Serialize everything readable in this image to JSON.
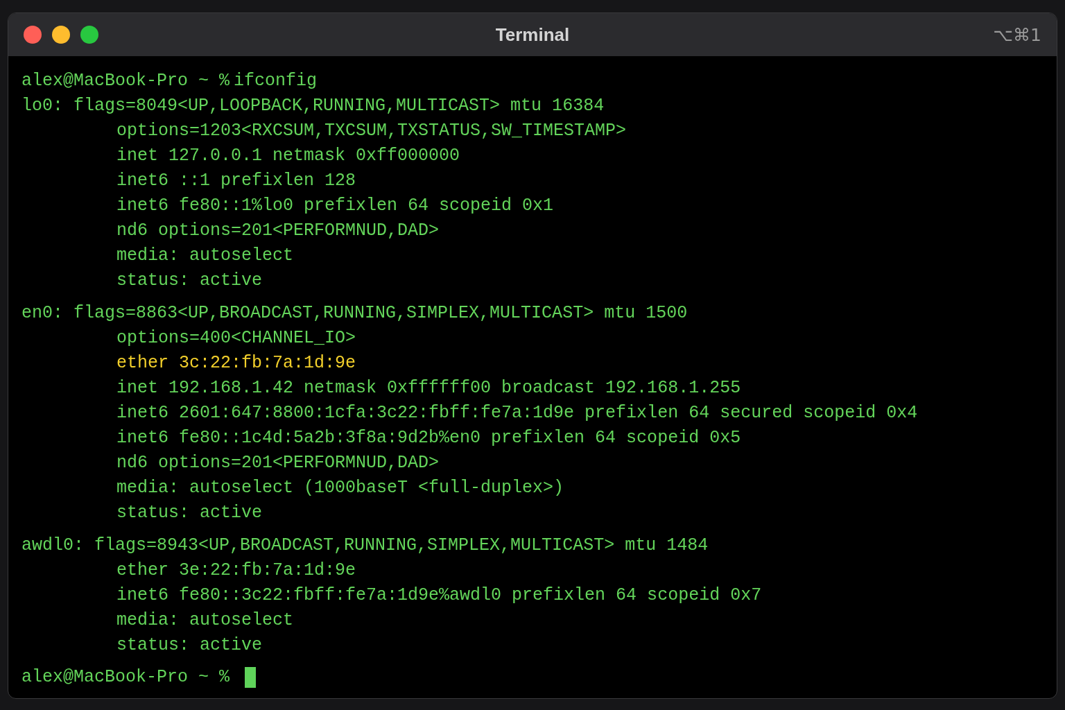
{
  "window": {
    "title": "Terminal",
    "shortcut": "⌥⌘1"
  },
  "command_line": {
    "prompt": "alex@MacBook-Pro ~ %",
    "command": "ifconfig"
  },
  "interfaces": [
    {
      "header": "lo0: flags=8049<UP,LOOPBACK,RUNNING,MULTICAST> mtu 16384",
      "details": [
        {
          "text": "options=1203<RXCSUM,TXCSUM,TXSTATUS,SW_TIMESTAMP>",
          "highlighted": false
        },
        {
          "text": "inet 127.0.0.1 netmask 0xff000000",
          "highlighted": false
        },
        {
          "text": "inet6 ::1 prefixlen 128",
          "highlighted": false
        },
        {
          "text": "inet6 fe80::1%lo0 prefixlen 64 scopeid 0x1",
          "highlighted": false
        },
        {
          "text": "nd6 options=201<PERFORMNUD,DAD>",
          "highlighted": false
        },
        {
          "text": "media: autoselect",
          "highlighted": false
        },
        {
          "text": "status: active",
          "highlighted": false
        }
      ]
    },
    {
      "header": "en0: flags=8863<UP,BROADCAST,RUNNING,SIMPLEX,MULTICAST> mtu 1500",
      "details": [
        {
          "text": "options=400<CHANNEL_IO>",
          "highlighted": false
        },
        {
          "text": "ether 3c:22:fb:7a:1d:9e",
          "highlighted": true
        },
        {
          "text": "inet 192.168.1.42 netmask 0xffffff00 broadcast 192.168.1.255",
          "highlighted": false
        },
        {
          "text": "inet6 2601:647:8800:1cfa:3c22:fbff:fe7a:1d9e prefixlen 64 secured scopeid 0x4",
          "highlighted": false
        },
        {
          "text": "inet6 fe80::1c4d:5a2b:3f8a:9d2b%en0 prefixlen 64 scopeid 0x5",
          "highlighted": false
        },
        {
          "text": "nd6 options=201<PERFORMNUD,DAD>",
          "highlighted": false
        },
        {
          "text": "media: autoselect (1000baseT <full-duplex>)",
          "highlighted": false
        },
        {
          "text": "status: active",
          "highlighted": false
        }
      ]
    },
    {
      "header": "awdl0: flags=8943<UP,BROADCAST,RUNNING,SIMPLEX,MULTICAST> mtu 1484",
      "details": [
        {
          "text": "ether 3e:22:fb:7a:1d:9e",
          "highlighted": false
        },
        {
          "text": "inet6 fe80::3c22:fbff:fe7a:1d9e%awdl0 prefixlen 64 scopeid 0x7",
          "highlighted": false
        },
        {
          "text": "media: autoselect",
          "highlighted": false
        },
        {
          "text": "status: active",
          "highlighted": false
        }
      ]
    }
  ],
  "final_prompt": {
    "prompt": "alex@MacBook-Pro ~ %",
    "cursor": true
  }
}
